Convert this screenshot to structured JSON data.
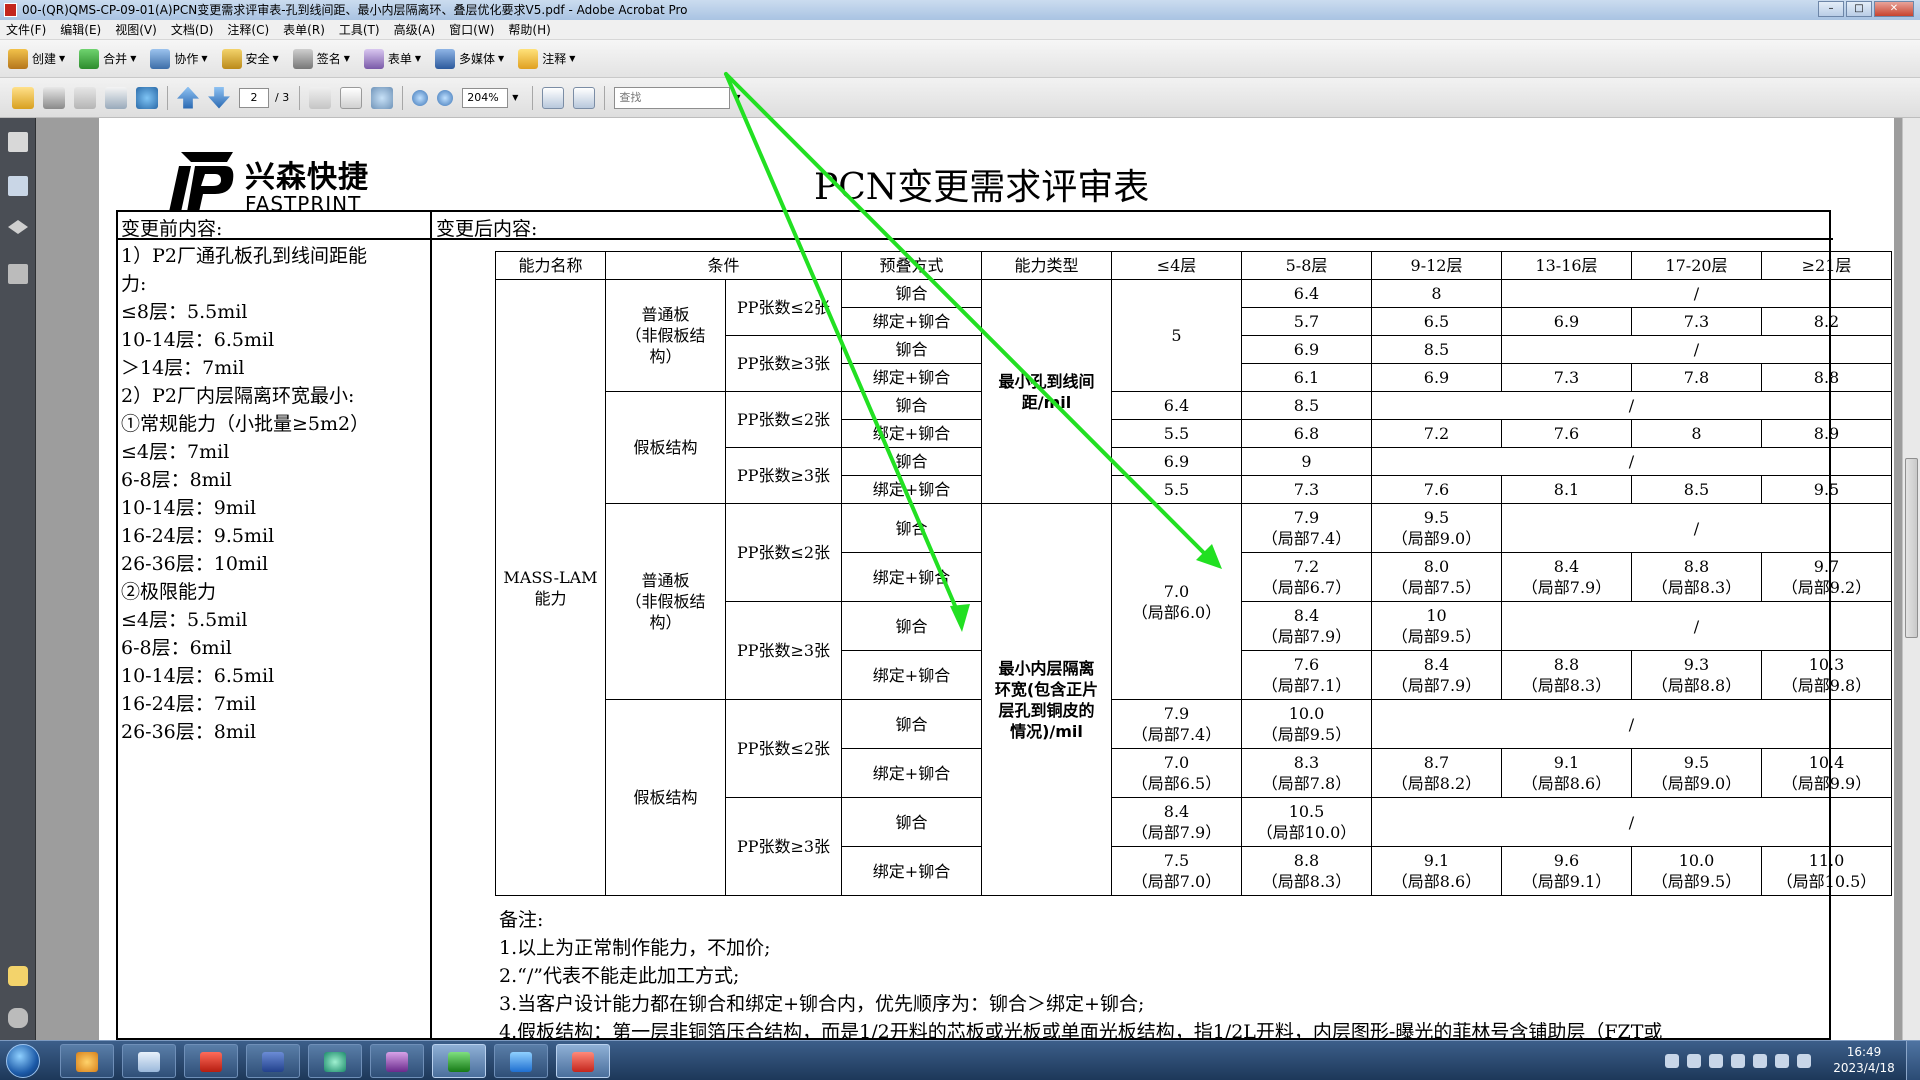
{
  "window": {
    "title": "00-(QR)QMS-CP-09-01(A)PCN变更需求评审表-孔到线间距、最小内层隔离环、叠层优化要求V5.pdf - Adobe Acrobat Pro",
    "min": "–",
    "max": "□",
    "close": "✕"
  },
  "menu": [
    "文件(F)",
    "编辑(E)",
    "视图(V)",
    "文档(D)",
    "注释(C)",
    "表单(R)",
    "工具(T)",
    "高级(A)",
    "窗口(W)",
    "帮助(H)"
  ],
  "toolbar1": {
    "create": "创建",
    "combine": "合并",
    "collaborate": "协作",
    "secure": "安全",
    "sign": "签名",
    "forms": "表单",
    "multimedia": "多媒体",
    "comment": "注释"
  },
  "toolbar2": {
    "page_current": "2",
    "page_total": "/ 3",
    "zoom": "204%",
    "find_placeholder": "查找"
  },
  "doc": {
    "logo_cn": "兴森快捷",
    "logo_en": "FASTPRINT",
    "title": "PCN变更需求评审表",
    "before_header": "变更前内容:",
    "after_header": "变更后内容:",
    "before_lines": [
      "1）P2厂通孔板孔到线间距能",
      "力:",
      "≤8层：5.5mil",
      "10-14层：6.5mil",
      "＞14层：7mil",
      "2）P2厂内层隔离环宽最小:",
      "①常规能力（小批量≥5m2）",
      "≤4层：7mil",
      "6-8层：8mil",
      "10-14层：9mil",
      "16-24层：9.5mil",
      "26-36层：10mil",
      "②极限能力",
      "≤4层：5.5mil",
      "6-8层：6mil",
      "10-14层：6.5mil",
      "16-24层：7mil",
      "26-36层：8mil"
    ],
    "table": {
      "headers": [
        "能力名称",
        "条件",
        "预叠方式",
        "能力类型",
        "≤4层",
        "5-8层",
        "9-12层",
        "13-16层",
        "17-20层",
        "≥21层"
      ],
      "mass_lam": "MASS-LAM\n能力",
      "normal_board": "普通板\n（非假板结\n构）",
      "fake_board": "假板结构",
      "pp_le2": "PP张数≤2张",
      "pp_ge3": "PP张数≥3张",
      "rivet": "铆合",
      "bind_rivet": "绑定+铆合",
      "type1": "最小孔到线间\n距/mil",
      "type2": "最小内层隔离\n环宽(包含正片\n层孔到铜皮的\n情况)/mil",
      "slash": "/",
      "v": {
        "a1": "6.4",
        "a2": "8",
        "b1": "5.7",
        "b2": "6.5",
        "b3": "6.9",
        "b4": "7.3",
        "b5": "8.2",
        "c1": "6.9",
        "c2": "8.5",
        "d1": "6.1",
        "d2": "6.9",
        "d3": "7.3",
        "d4": "7.8",
        "d5": "8.8",
        "g5": "5",
        "e0": "6.4",
        "e1": "8.5",
        "f0": "5.5",
        "f1": "6.8",
        "f2": "7.2",
        "f3": "7.6",
        "f4": "8",
        "f5": "8.9",
        "h0": "6.9",
        "h1": "9",
        "i0": "5.5",
        "i1": "7.3",
        "i2": "7.6",
        "i3": "8.1",
        "i4": "8.5",
        "i5": "9.5",
        "j1": "7.9\n（局部7.4）",
        "j2": "9.5\n（局部9.0）",
        "k1": "7.2\n（局部6.7）",
        "k2": "8.0\n（局部7.5）",
        "k3": "8.4\n（局部7.9）",
        "k4": "8.8\n（局部8.3）",
        "k5": "9.7\n（局部9.2）",
        "l1": "8.4\n（局部7.9）",
        "l2": "10\n（局部9.5）",
        "m1": "7.6\n（局部7.1）",
        "m2": "8.4\n（局部7.9）",
        "m3": "8.8\n（局部8.3）",
        "m4": "9.3\n（局部8.8）",
        "m5": "10.3\n（局部9.8）",
        "n0": "7.0\n（局部6.0）",
        "o0": "7.9\n（局部7.4）",
        "o1": "10.0\n（局部9.5）",
        "p0": "7.0\n（局部6.5）",
        "p1": "8.3\n（局部7.8）",
        "p2": "8.7\n（局部8.2）",
        "p3": "9.1\n（局部8.6）",
        "p4": "9.5\n（局部9.0）",
        "p5": "10.4\n（局部9.9）",
        "q0": "8.4\n（局部7.9）",
        "q1": "10.5\n（局部10.0）",
        "r0": "7.5\n（局部7.0）",
        "r1": "8.8\n（局部8.3）",
        "r2": "9.1\n（局部8.6）",
        "r3": "9.6\n（局部9.1）",
        "r4": "10.0\n（局部9.5）",
        "r5": "11.0\n（局部10.5）"
      }
    },
    "notes": [
      "备注:",
      "1.以上为正常制作能力，不加价;",
      "2.“/”代表不能走此加工方式;",
      "3.当客户设计能力都在铆合和绑定+铆合内，优先顺序为：铆合＞绑定+铆合;",
      "4.假板结构：第一层非铜箔压合结构，而是1/2开料的芯板或光板或单面光板结构，指1/2L开料，内层图形-曝光的菲林号含铺助层（FZT或"
    ]
  },
  "taskbar": {
    "time": "16:49",
    "date": "2023/4/18"
  },
  "colors": {
    "annotation_arrow": "#22e022",
    "acrobat_red": "#c3261d"
  }
}
